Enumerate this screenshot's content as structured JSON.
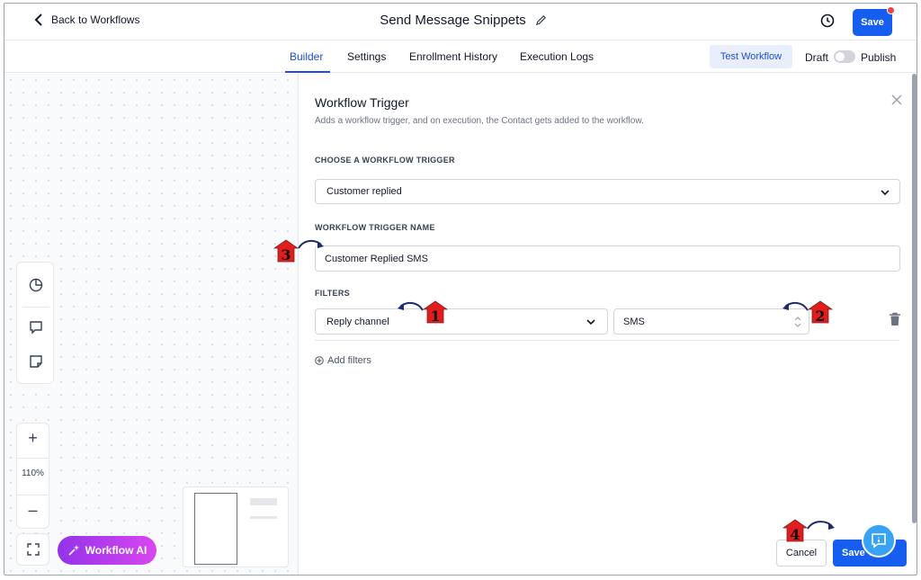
{
  "header": {
    "back_label": "Back to Workflows",
    "title": "Send Message Snippets",
    "save_label": "Save"
  },
  "tabs": [
    {
      "label": "Builder",
      "active": true
    },
    {
      "label": "Settings",
      "active": false
    },
    {
      "label": "Enrollment History",
      "active": false
    },
    {
      "label": "Execution Logs",
      "active": false
    }
  ],
  "tabbar_right": {
    "test_label": "Test Workflow",
    "draft_label": "Draft",
    "publish_label": "Publish",
    "published": false
  },
  "canvas": {
    "zoom_in": "+",
    "zoom_level": "110%",
    "zoom_out": "–",
    "ai_label": "Workflow AI"
  },
  "trigger_panel": {
    "title": "Workflow Trigger",
    "subtitle": "Adds a workflow trigger, and on execution, the Contact gets added to the workflow.",
    "choose_label": "CHOOSE A WORKFLOW TRIGGER",
    "trigger_value": "Customer replied",
    "name_label": "WORKFLOW TRIGGER NAME",
    "name_value": "Customer Replied SMS",
    "filters_label": "FILTERS",
    "filter_field": "Reply channel",
    "filter_value": "SMS",
    "add_filters_label": "Add filters",
    "cancel_label": "Cancel",
    "save_label": "Save T"
  },
  "annotations": [
    "1",
    "2",
    "3",
    "4"
  ],
  "colors": {
    "primary": "#155eef",
    "annotation_red": "#e11d1d",
    "annotation_arrow": "#1e2a6e"
  }
}
